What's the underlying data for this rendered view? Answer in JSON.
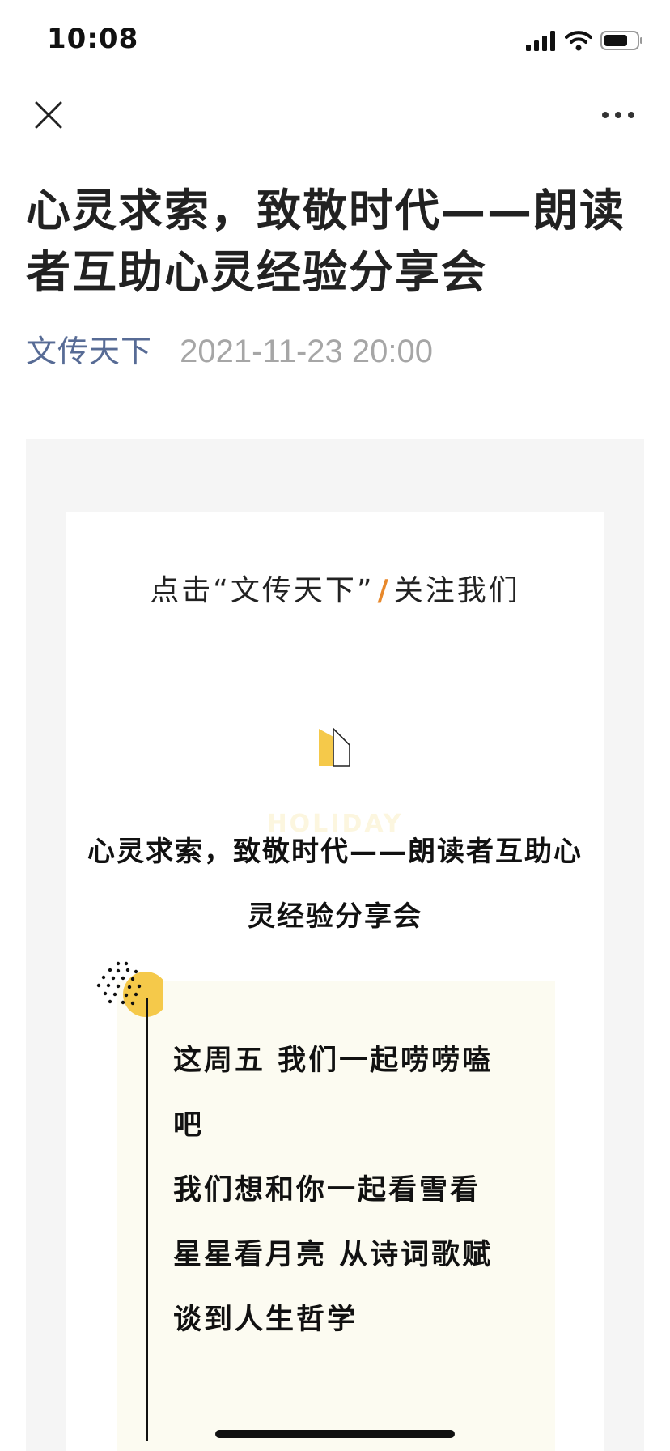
{
  "status_bar": {
    "time": "10:08",
    "icons": [
      "cellular-signal-icon",
      "wifi-icon",
      "battery-icon"
    ]
  },
  "nav": {
    "close_icon": "close-icon",
    "more_icon": "more-dots-icon"
  },
  "article": {
    "title": "心灵求索，致敬时代——朗读者互助心灵经验分享会",
    "author": "文传天下",
    "date": "2021-11-23 20:00"
  },
  "content": {
    "follow_prefix": "点击“文传天下”",
    "follow_slash": "/",
    "follow_suffix": "关注我们",
    "watermark": "HOLIDAY",
    "inner_title": "心灵求索，致敬时代——朗读者互助心灵经验分享会",
    "lines": [
      "这周五 我们一起唠唠嗑",
      "吧",
      "我们想和你一起看雪看",
      "星星看月亮 从诗词歌赋",
      "谈到人生哲学"
    ]
  },
  "colors": {
    "author_link": "#576b95",
    "date": "#a6a6a6",
    "accent_orange": "#e8892c",
    "accent_yellow": "#f5c94a",
    "panel_gray": "#f5f5f5",
    "cream": "#fcfbf1"
  }
}
